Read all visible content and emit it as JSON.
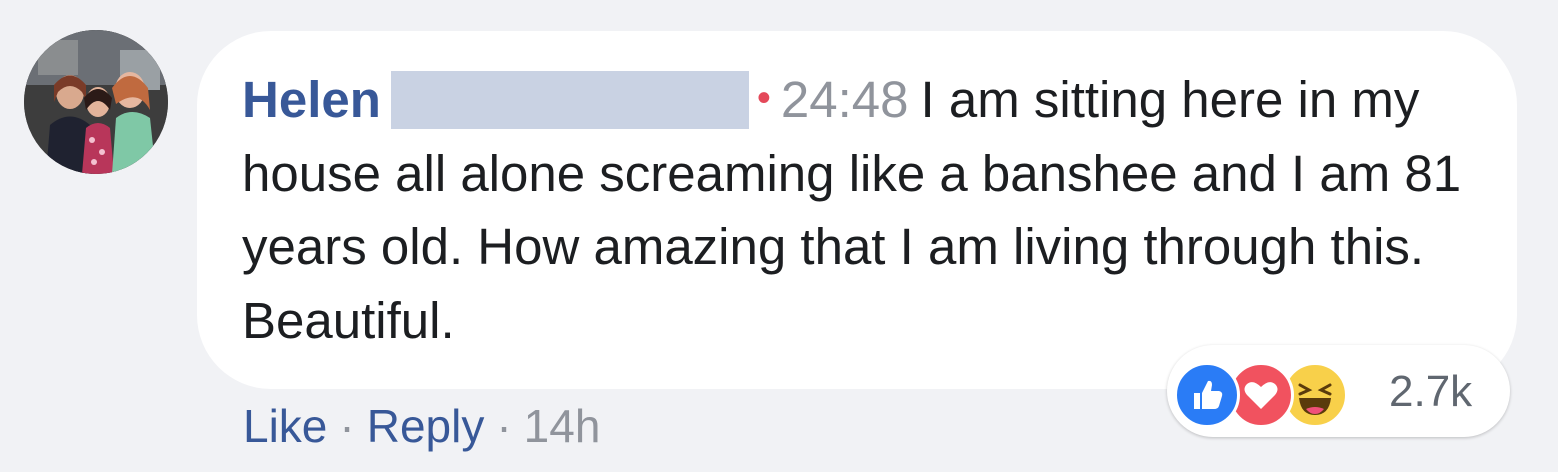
{
  "comment": {
    "author_first_name": "Helen",
    "video_timestamp": "24:48",
    "text": "I am sitting here in my house all alone screaming like a banshee and I am 81 years old. How amazing that I am living through this. Beautiful."
  },
  "reactions": {
    "icons": [
      "like-icon",
      "love-icon",
      "haha-icon"
    ],
    "count": "2.7k"
  },
  "actions": {
    "like_label": "Like",
    "reply_label": "Reply",
    "time_ago": "14h",
    "separator": "·"
  },
  "colors": {
    "link_blue": "#385898",
    "meta_gray": "#90949c",
    "like_blue": "#2a7cf6",
    "love_red": "#f1525f",
    "haha_yellow": "#f8d04a",
    "live_dot_red": "#e4495a",
    "bubble_bg": "#ffffff",
    "page_bg": "#f1f2f5"
  }
}
